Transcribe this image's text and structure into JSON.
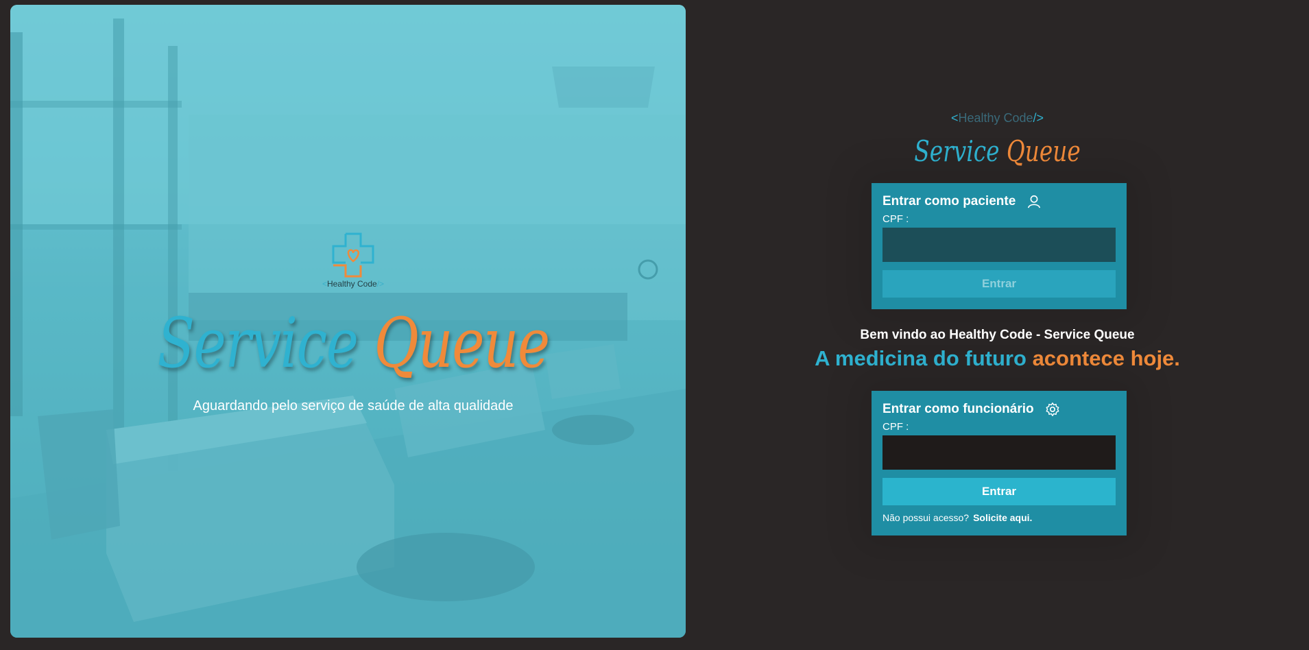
{
  "hero": {
    "logo_text_prefix": "<",
    "logo_text": "Healthy Code",
    "logo_text_suffix": "/>",
    "title_part1": "Service",
    "title_part2": "Queue",
    "subtitle": "Aguardando pelo serviço de saúde de alta qualidade"
  },
  "brand": {
    "small_prefix": "<",
    "small_text": "Healthy Code",
    "small_suffix": "/>",
    "title_part1": "Service",
    "title_part2": "Queue"
  },
  "patient_card": {
    "title": "Entrar como paciente",
    "icon": "user-icon",
    "cpf_label": "CPF :",
    "cpf_value": "",
    "button_label": "Entrar"
  },
  "welcome": {
    "heading": "Bem vindo ao Healthy Code - Service Queue",
    "tagline_part1": "A medicina do futuro",
    "tagline_part2": "acontece hoje."
  },
  "staff_card": {
    "title": "Entrar como funcionário",
    "icon": "gear-icon",
    "cpf_label": "CPF :",
    "cpf_value": "",
    "button_label": "Entrar",
    "no_access_text": "Não possui acesso?",
    "request_link": "Solicite aqui."
  },
  "colors": {
    "background": "#2a2626",
    "card": "#1f8ea4",
    "primary_blue": "#2fb2d0",
    "accent_orange": "#f08a3a"
  }
}
